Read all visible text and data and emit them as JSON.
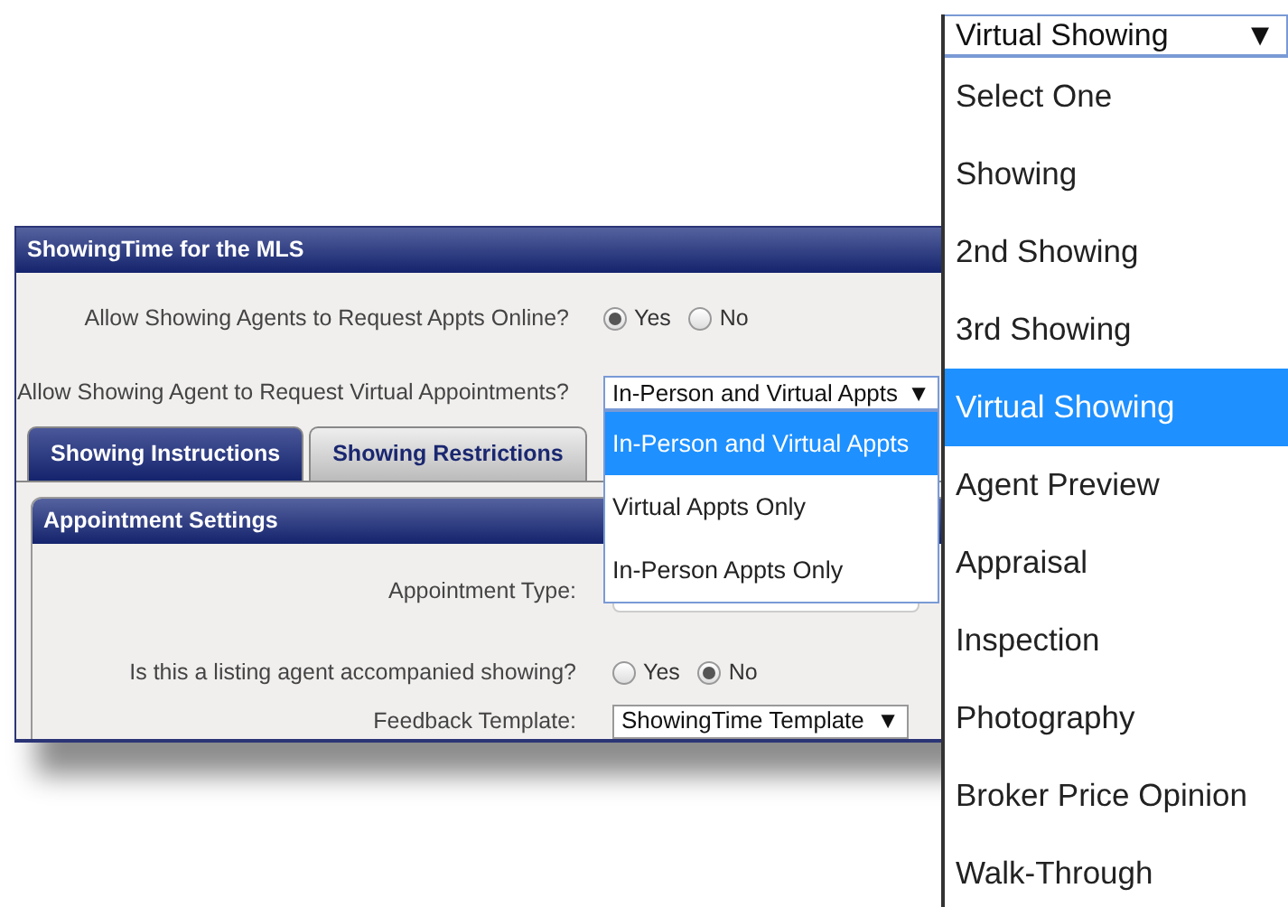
{
  "window": {
    "title": "ShowingTime for the MLS"
  },
  "settings": [
    {
      "label": "Allow Showing Agents to Request Appts Online?",
      "kind": "radio",
      "options": [
        {
          "label": "Yes",
          "selected": true
        },
        {
          "label": "No",
          "selected": false
        }
      ]
    },
    {
      "label": "Allow Showing Agent to Request Virtual Appointments?",
      "kind": "select",
      "value": "In-Person and Virtual Appts",
      "caret": "▼",
      "open": true,
      "options": [
        {
          "label": "In-Person and Virtual Appts",
          "selected": true
        },
        {
          "label": "Virtual Appts Only",
          "selected": false
        },
        {
          "label": "In-Person Appts Only",
          "selected": false
        }
      ]
    }
  ],
  "tabs": [
    {
      "label": "Showing Instructions",
      "selected": true
    },
    {
      "label": "Showing Restrictions",
      "selected": false
    }
  ],
  "section": {
    "title": "Appointment Settings",
    "fields": [
      {
        "label": "Appointment Type:",
        "kind": "text"
      },
      {
        "label": "Is this a listing agent accompanied showing?",
        "kind": "radio",
        "options": [
          {
            "label": "Yes",
            "selected": false
          },
          {
            "label": "No",
            "selected": true
          }
        ]
      },
      {
        "label": "Feedback Template:",
        "kind": "select",
        "value": "ShowingTime Template",
        "caret": "▼",
        "open": false
      }
    ]
  },
  "showing_type_select": {
    "value": "Virtual Showing",
    "caret": "▼",
    "open": true,
    "options": [
      {
        "label": "Select One",
        "selected": false
      },
      {
        "label": "Showing",
        "selected": false
      },
      {
        "label": "2nd Showing",
        "selected": false
      },
      {
        "label": "3rd Showing",
        "selected": false
      },
      {
        "label": "Virtual Showing",
        "selected": true
      },
      {
        "label": "Agent Preview",
        "selected": false
      },
      {
        "label": "Appraisal",
        "selected": false
      },
      {
        "label": "Inspection",
        "selected": false
      },
      {
        "label": "Photography",
        "selected": false
      },
      {
        "label": "Broker Price Opinion",
        "selected": false
      },
      {
        "label": "Walk-Through",
        "selected": false
      }
    ]
  }
}
